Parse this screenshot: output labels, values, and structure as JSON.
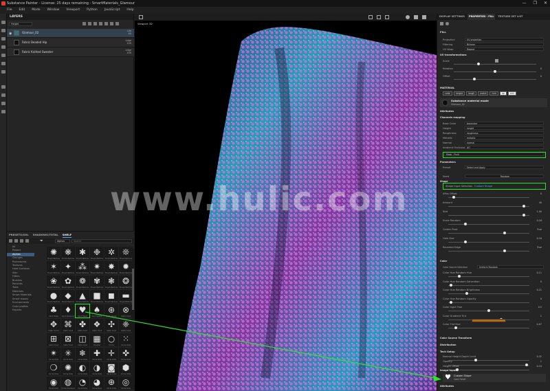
{
  "window": {
    "title": "Substance Painter - License: 25 days remaining - SmartMaterials_Glamour",
    "controls": [
      "—",
      "❐",
      "✕"
    ]
  },
  "menu": [
    "File",
    "Edit",
    "Mode",
    "Window",
    "Viewport",
    "Python",
    "JavaScript",
    "Help"
  ],
  "layers": {
    "title": "LAYERS",
    "channel": "Height",
    "rows": [
      {
        "name": "Glamour_02",
        "blend": "Lde",
        "opacity": "60",
        "selected": true
      },
      {
        "name": "Fabric Beaded Hip",
        "blend": "Ldge",
        "opacity": "100",
        "selected": false
      },
      {
        "name": "Fabric Knitted Sweater",
        "blend": "Ldge",
        "opacity": "100",
        "selected": false
      }
    ]
  },
  "shelf": {
    "tabs": [
      "PRESETS/SOL",
      "SHADOWS/TOTAL",
      "SHELF"
    ],
    "active_tab": "SHELF",
    "filter": "Alphas",
    "search_placeholder": "Search",
    "categories": [
      "All",
      "Project",
      "Alphas",
      "Grunges",
      "Procedurals",
      "Textures",
      "Hard Surfaces",
      "Skin",
      "Filters",
      "Brushes",
      "Particles",
      "Tools",
      "Materials",
      "Smart Materials",
      "Smart masks",
      "Environments",
      "Color profiles",
      "Exports"
    ],
    "selected_category": "Alphas",
    "grid": [
      {
        "label": "Brush Particle",
        "glyph": "✺"
      },
      {
        "label": "Brush Particle",
        "glyph": "❋"
      },
      {
        "label": "Brush Particle",
        "glyph": "✱"
      },
      {
        "label": "Brush Particle",
        "glyph": "❉"
      },
      {
        "label": "Brush Particle",
        "glyph": "✲"
      },
      {
        "label": "Brush Particle",
        "glyph": "❊"
      },
      {
        "label": "Brush Particle",
        "glyph": "✶"
      },
      {
        "label": "Brush Particle",
        "glyph": "✦"
      },
      {
        "label": "Brush Particle",
        "glyph": "⁂"
      },
      {
        "label": "Brush Particle",
        "glyph": "✷"
      },
      {
        "label": "Brush Particle",
        "glyph": "✸"
      },
      {
        "label": "Brush Particle",
        "glyph": "✹"
      },
      {
        "label": "Brush Particle",
        "glyph": "❀"
      },
      {
        "label": "Brush Particle",
        "glyph": "✿"
      },
      {
        "label": "Brush Particle",
        "glyph": "❁"
      },
      {
        "label": "Brush Particle",
        "glyph": "✾"
      },
      {
        "label": "Brush Particle",
        "glyph": "❃"
      },
      {
        "label": "Brush Particle",
        "glyph": "❂"
      },
      {
        "label": "Brush Particle",
        "glyph": "●"
      },
      {
        "label": "Brush Particle",
        "glyph": "◆"
      },
      {
        "label": "Brush Particle",
        "glyph": "▲"
      },
      {
        "label": "Brush Particle",
        "glyph": "■"
      },
      {
        "label": "Brush Particle",
        "glyph": "◼"
      },
      {
        "label": "Brush Particle",
        "glyph": "▬"
      },
      {
        "label": "Card Clubs",
        "glyph": "♣"
      },
      {
        "label": "Card Diamond",
        "glyph": "♦"
      },
      {
        "label": "Card Heart",
        "glyph": "♥"
      },
      {
        "label": "Card Spade",
        "glyph": "♠"
      },
      {
        "label": "Celtic Cross",
        "glyph": "⊕"
      },
      {
        "label": "Celtic Knot",
        "glyph": "⊗"
      },
      {
        "label": "Celtic Circle",
        "glyph": "✥"
      },
      {
        "label": "Celtic Knot",
        "glyph": "⌘"
      },
      {
        "label": "Celtic Knot",
        "glyph": "✤"
      },
      {
        "label": "Celtic Knot",
        "glyph": "❖"
      },
      {
        "label": "Celtic Knot",
        "glyph": "✣"
      },
      {
        "label": "Celtic Knot",
        "glyph": "❈"
      },
      {
        "label": "Celtic Knot",
        "glyph": "⊞"
      },
      {
        "label": "Celtic Knot",
        "glyph": "⊠"
      },
      {
        "label": "Celtic Knot",
        "glyph": "◫"
      },
      {
        "label": "Checker",
        "glyph": "▦"
      },
      {
        "label": "Circle",
        "glyph": "○"
      },
      {
        "label": "Circle Dots",
        "glyph": "⁙"
      },
      {
        "label": "Circle Dots",
        "glyph": "✴"
      },
      {
        "label": "Circle Dots",
        "glyph": "✳"
      },
      {
        "label": "Circle Dots",
        "glyph": "❄"
      },
      {
        "label": "Circle Dots",
        "glyph": "✚"
      },
      {
        "label": "Circle Dots",
        "glyph": "✛"
      },
      {
        "label": "Circle Dots",
        "glyph": "✜"
      },
      {
        "label": "Circle Dots",
        "glyph": "❍"
      },
      {
        "label": "Circle Dots",
        "glyph": "✺"
      },
      {
        "label": "Circle Dots",
        "glyph": "◐"
      },
      {
        "label": "Circle Dots",
        "glyph": "◑"
      },
      {
        "label": "Circle Dots",
        "glyph": "◙"
      },
      {
        "label": "Circle Dots",
        "glyph": "⬢"
      },
      {
        "label": "Circle Dots",
        "glyph": "◉"
      },
      {
        "label": "Circle Gradient",
        "glyph": "◍"
      },
      {
        "label": "Circle Dots",
        "glyph": "◔"
      },
      {
        "label": "Circle Dots",
        "glyph": "◕"
      },
      {
        "label": "Circle Dots",
        "glyph": "⊕"
      },
      {
        "label": "Circle Dots",
        "glyph": "◎"
      }
    ]
  },
  "viewport": {
    "label": "Viewport 3D",
    "toolbar_icons": [
      "grid-icon",
      "cube-icon",
      "camera-icon",
      "settings-icon",
      "help-icon",
      "user-icon"
    ]
  },
  "watermark": "www.hulic.com",
  "right": {
    "tabs": [
      "DISPLAY SETTINGS",
      "PROPERTIES - FILL",
      "TEXTURE SET LIST"
    ],
    "active_tab": "PROPERTIES - FILL",
    "fill_header": "FILL",
    "projection_label": "Projection",
    "projection": "UV projection",
    "filtering_label": "Filtering",
    "filtering": "Bilinear",
    "uvwrap_label": "UV Wrap",
    "uvwrap": "Repeat",
    "uvtrans": "UV transformations",
    "scale_label": "Scale",
    "scale_val": "1",
    "rotation_label": "Rotation",
    "rotation_val": "0",
    "offset_label": "Offset",
    "offset_val": "0",
    "material_header": "MATERIAL",
    "channels": [
      "color",
      "height",
      "rough",
      "metal",
      "nrm",
      "op",
      "emi"
    ],
    "active_channels": [
      "op",
      "emi"
    ],
    "mat_name": "Substance material mode",
    "mat_sub": "Glamour_02",
    "attributes": "Attributes",
    "chmap": "Channels mapping",
    "chmap_rows": [
      {
        "label": "Base Color",
        "val": "basecolor"
      },
      {
        "label": "Height",
        "val": "height"
      },
      {
        "label": "Roughness",
        "val": "roughness"
      },
      {
        "label": "Metallic",
        "val": "metallic"
      },
      {
        "label": "Normal",
        "val": "normal"
      },
      {
        "label": "Ambient Occlusion",
        "val": "AO"
      }
    ],
    "mask_row": "Mask - Push",
    "parameters": "Parameters",
    "preset_label": "Preset",
    "preset": "Select and Apply",
    "seed_label": "Seed",
    "seed_button": "Random",
    "shape_label": "Shape",
    "shape_sel": "Shape Input Selection",
    "shape_val": "Custom Shape",
    "param_sliders": [
      {
        "label": "XPos Offset",
        "value": "0",
        "pos": 0.05
      },
      {
        "label": "Amount",
        "value": "40",
        "pos": 0.95
      },
      {
        "label": "Size",
        "value": "1.00",
        "pos": 0.95
      },
      {
        "label": "Scale Random",
        "value": "0.16",
        "pos": 0.2
      },
      {
        "label": "Center Pixel",
        "value": "True",
        "pos": 0.7
      },
      {
        "label": "Hole Size",
        "value": "0.16",
        "pos": 0.2
      },
      {
        "label": "Rounded Edge",
        "value": "True",
        "pos": 0.7
      }
    ],
    "color_section": "Color",
    "color_source_label": "Color Source Selection",
    "color_source": "Uniform Random",
    "color_sliders": [
      {
        "label": "Color Hue Random Hue",
        "value": "0.11",
        "pos": 0.12
      },
      {
        "label": "Color Hue Random Saturation",
        "value": "0",
        "pos": 0.02
      },
      {
        "label": "Color Hue Random Brightness",
        "value": "0.21",
        "pos": 0.22
      },
      {
        "label": "Color Hue Random Opacity",
        "value": "0",
        "pos": 0.02
      },
      {
        "label": "Color Input Hue",
        "value": "0.5",
        "pos": 0.5
      },
      {
        "label": "Color Gradient Tint",
        "value": "1",
        "pos": 0.66
      },
      {
        "label": "Color Tint Hue",
        "value": "0.07",
        "pos": 0.08
      }
    ],
    "tint_color": "#b76a15",
    "cst_section": "Color Source Transform",
    "dist_section": "Distribution",
    "tech_section": "Tech Setup",
    "tech_sliders": [
      {
        "label": "Normal Height Depth Limit",
        "value": "0.32",
        "pos": 0.33
      },
      {
        "label": "Opacity",
        "value": "1",
        "pos": 0.98
      },
      {
        "label": "Height Offset",
        "value": "0.10",
        "pos": 0.1
      }
    ],
    "image_inputs": "Image Inputs",
    "custom_shape_label": "Custom Shape",
    "custom_shape_sub": "Card Heart",
    "attributes2": "Attributes"
  },
  "colors": {
    "highlight": "#2ee22e",
    "accent": "#3d5b80"
  }
}
